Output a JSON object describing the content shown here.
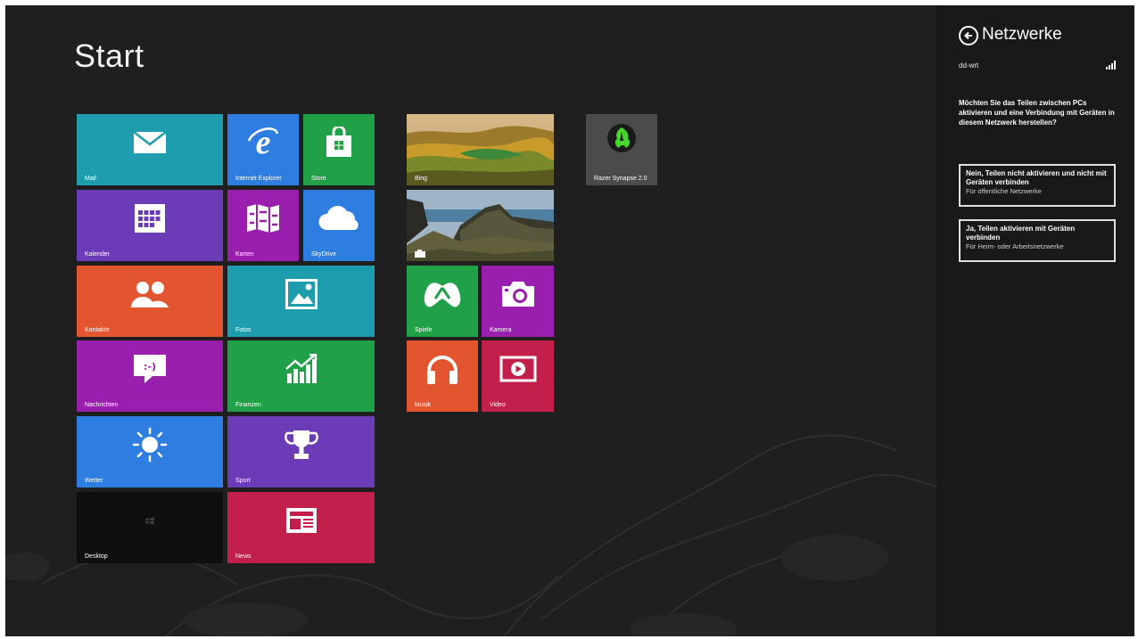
{
  "start": {
    "title": "Start"
  },
  "tiles": {
    "mail": "Mail",
    "internet_explorer": "Internet Explorer",
    "store": "Store",
    "bing": "Bing",
    "razer": "Razer Synapse 2.0",
    "kalender": "Kalender",
    "karten": "Karten",
    "skydrive": "SkyDrive",
    "kontakte": "Kontakte",
    "fotos": "Fotos",
    "spiele": "Spiele",
    "kamera": "Kamera",
    "nachrichten": "Nachrichten",
    "finanzen": "Finanzen",
    "musik": "Musik",
    "video": "Video",
    "wetter": "Wetter",
    "sport": "Sport",
    "desktop": "Desktop",
    "news": "News"
  },
  "tile_colors": {
    "teal": "#1e9dae",
    "blue": "#2d7ee0",
    "green": "#21a147",
    "purple": "#6c3cb8",
    "orange": "#e2552e",
    "magenta": "#9b1fae",
    "crimson": "#c21f4a"
  },
  "network_panel": {
    "title": "Netzwerke",
    "network_name": "dd-wrt",
    "question": "Möchten Sie das Teilen zwischen PCs aktivieren und eine Verbindung mit Geräten in diesem Netzwerk herstellen?",
    "option_no": {
      "label": "Nein, Teilen nicht aktivieren und nicht mit Geräten verbinden",
      "sub": "Für öffentliche Netzwerke"
    },
    "option_yes": {
      "label": "Ja, Teilen aktivieren mit Geräten verbinden",
      "sub": "Für Heim- oder Arbeitsnetzwerke"
    }
  }
}
